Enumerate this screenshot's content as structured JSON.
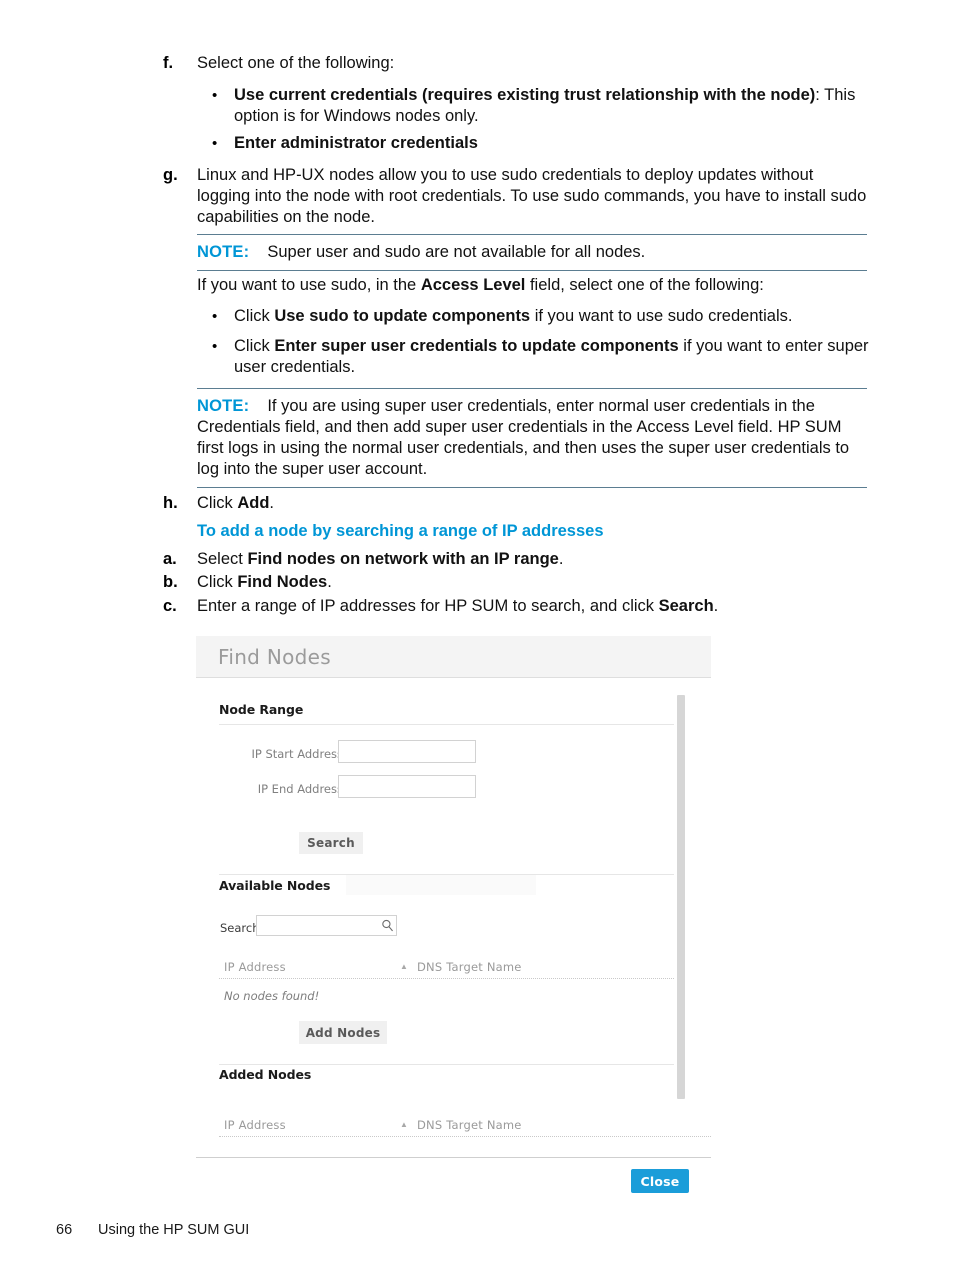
{
  "page": {
    "footer_page_number": "66",
    "footer_title": "Using the HP SUM GUI"
  },
  "steps": {
    "f": {
      "letter": "f.",
      "text": "Select one of the following:",
      "bullets": [
        {
          "marker": "•",
          "bold": "Use current credentials (requires existing trust relationship with the node)",
          "rest": ": This option is for Windows nodes only."
        },
        {
          "marker": "•",
          "bold": "Enter administrator credentials",
          "rest": ""
        }
      ]
    },
    "g": {
      "letter": "g.",
      "text": "Linux and HP-UX nodes allow you to use sudo credentials to deploy updates without logging into the node with root credentials. To use sudo commands, you have to install sudo capabilities on the node."
    },
    "h": {
      "letter": "h.",
      "prefix": "Click ",
      "bold": "Add",
      "suffix": "."
    }
  },
  "note1": {
    "label": "NOTE:",
    "text": "Super user and sudo are not available for all nodes."
  },
  "access_level_para": {
    "prefix": "If you want to use sudo, in the ",
    "bold": "Access Level",
    "suffix": " field, select one of the following:"
  },
  "access_bullets": [
    {
      "marker": "•",
      "prefix": "Click ",
      "bold": "Use sudo to update components",
      "suffix": " if you want to use sudo credentials."
    },
    {
      "marker": "•",
      "prefix": "Click ",
      "bold": "Enter super user credentials to update components",
      "suffix": " if you want to enter super user credentials."
    }
  ],
  "note2": {
    "label": "NOTE:",
    "text": "If you are using super user credentials, enter normal user credentials in the Credentials field, and then add super user credentials in the Access Level field. HP SUM first logs in using the normal user credentials, and then uses the super user credentials to log into the super user account."
  },
  "section_heading": "To add a node by searching a range of IP addresses",
  "ip_steps": [
    {
      "letter": "a.",
      "prefix": "Select ",
      "bold": "Find nodes on network with an IP range",
      "suffix": "."
    },
    {
      "letter": "b.",
      "prefix": "Click ",
      "bold": "Find Nodes",
      "suffix": "."
    },
    {
      "letter": "c.",
      "prefix": "Enter a range of IP addresses for HP SUM to search, and click ",
      "bold": "Search",
      "suffix": "."
    }
  ],
  "dialog": {
    "title": "Find Nodes",
    "node_range": {
      "heading": "Node Range",
      "ip_start_label": "IP Start Address",
      "ip_start_value": "",
      "ip_end_label": "IP End Address",
      "ip_end_value": "",
      "search_button": "Search"
    },
    "available_nodes": {
      "heading": "Available Nodes",
      "search_label": "Search:",
      "search_value": "",
      "search_icon": "search-icon",
      "columns": [
        "IP Address",
        "DNS Target Name"
      ],
      "sort_indicator": "▲",
      "empty_message": "No nodes found!",
      "add_button": "Add Nodes"
    },
    "added_nodes": {
      "heading": "Added Nodes",
      "columns": [
        "IP Address",
        "DNS Target Name"
      ],
      "sort_indicator": "▲"
    },
    "close_button": "Close"
  },
  "colors": {
    "hp_blue": "#0096d6",
    "button_blue": "#1b9dd9",
    "note_rule": "#5b7d91"
  }
}
